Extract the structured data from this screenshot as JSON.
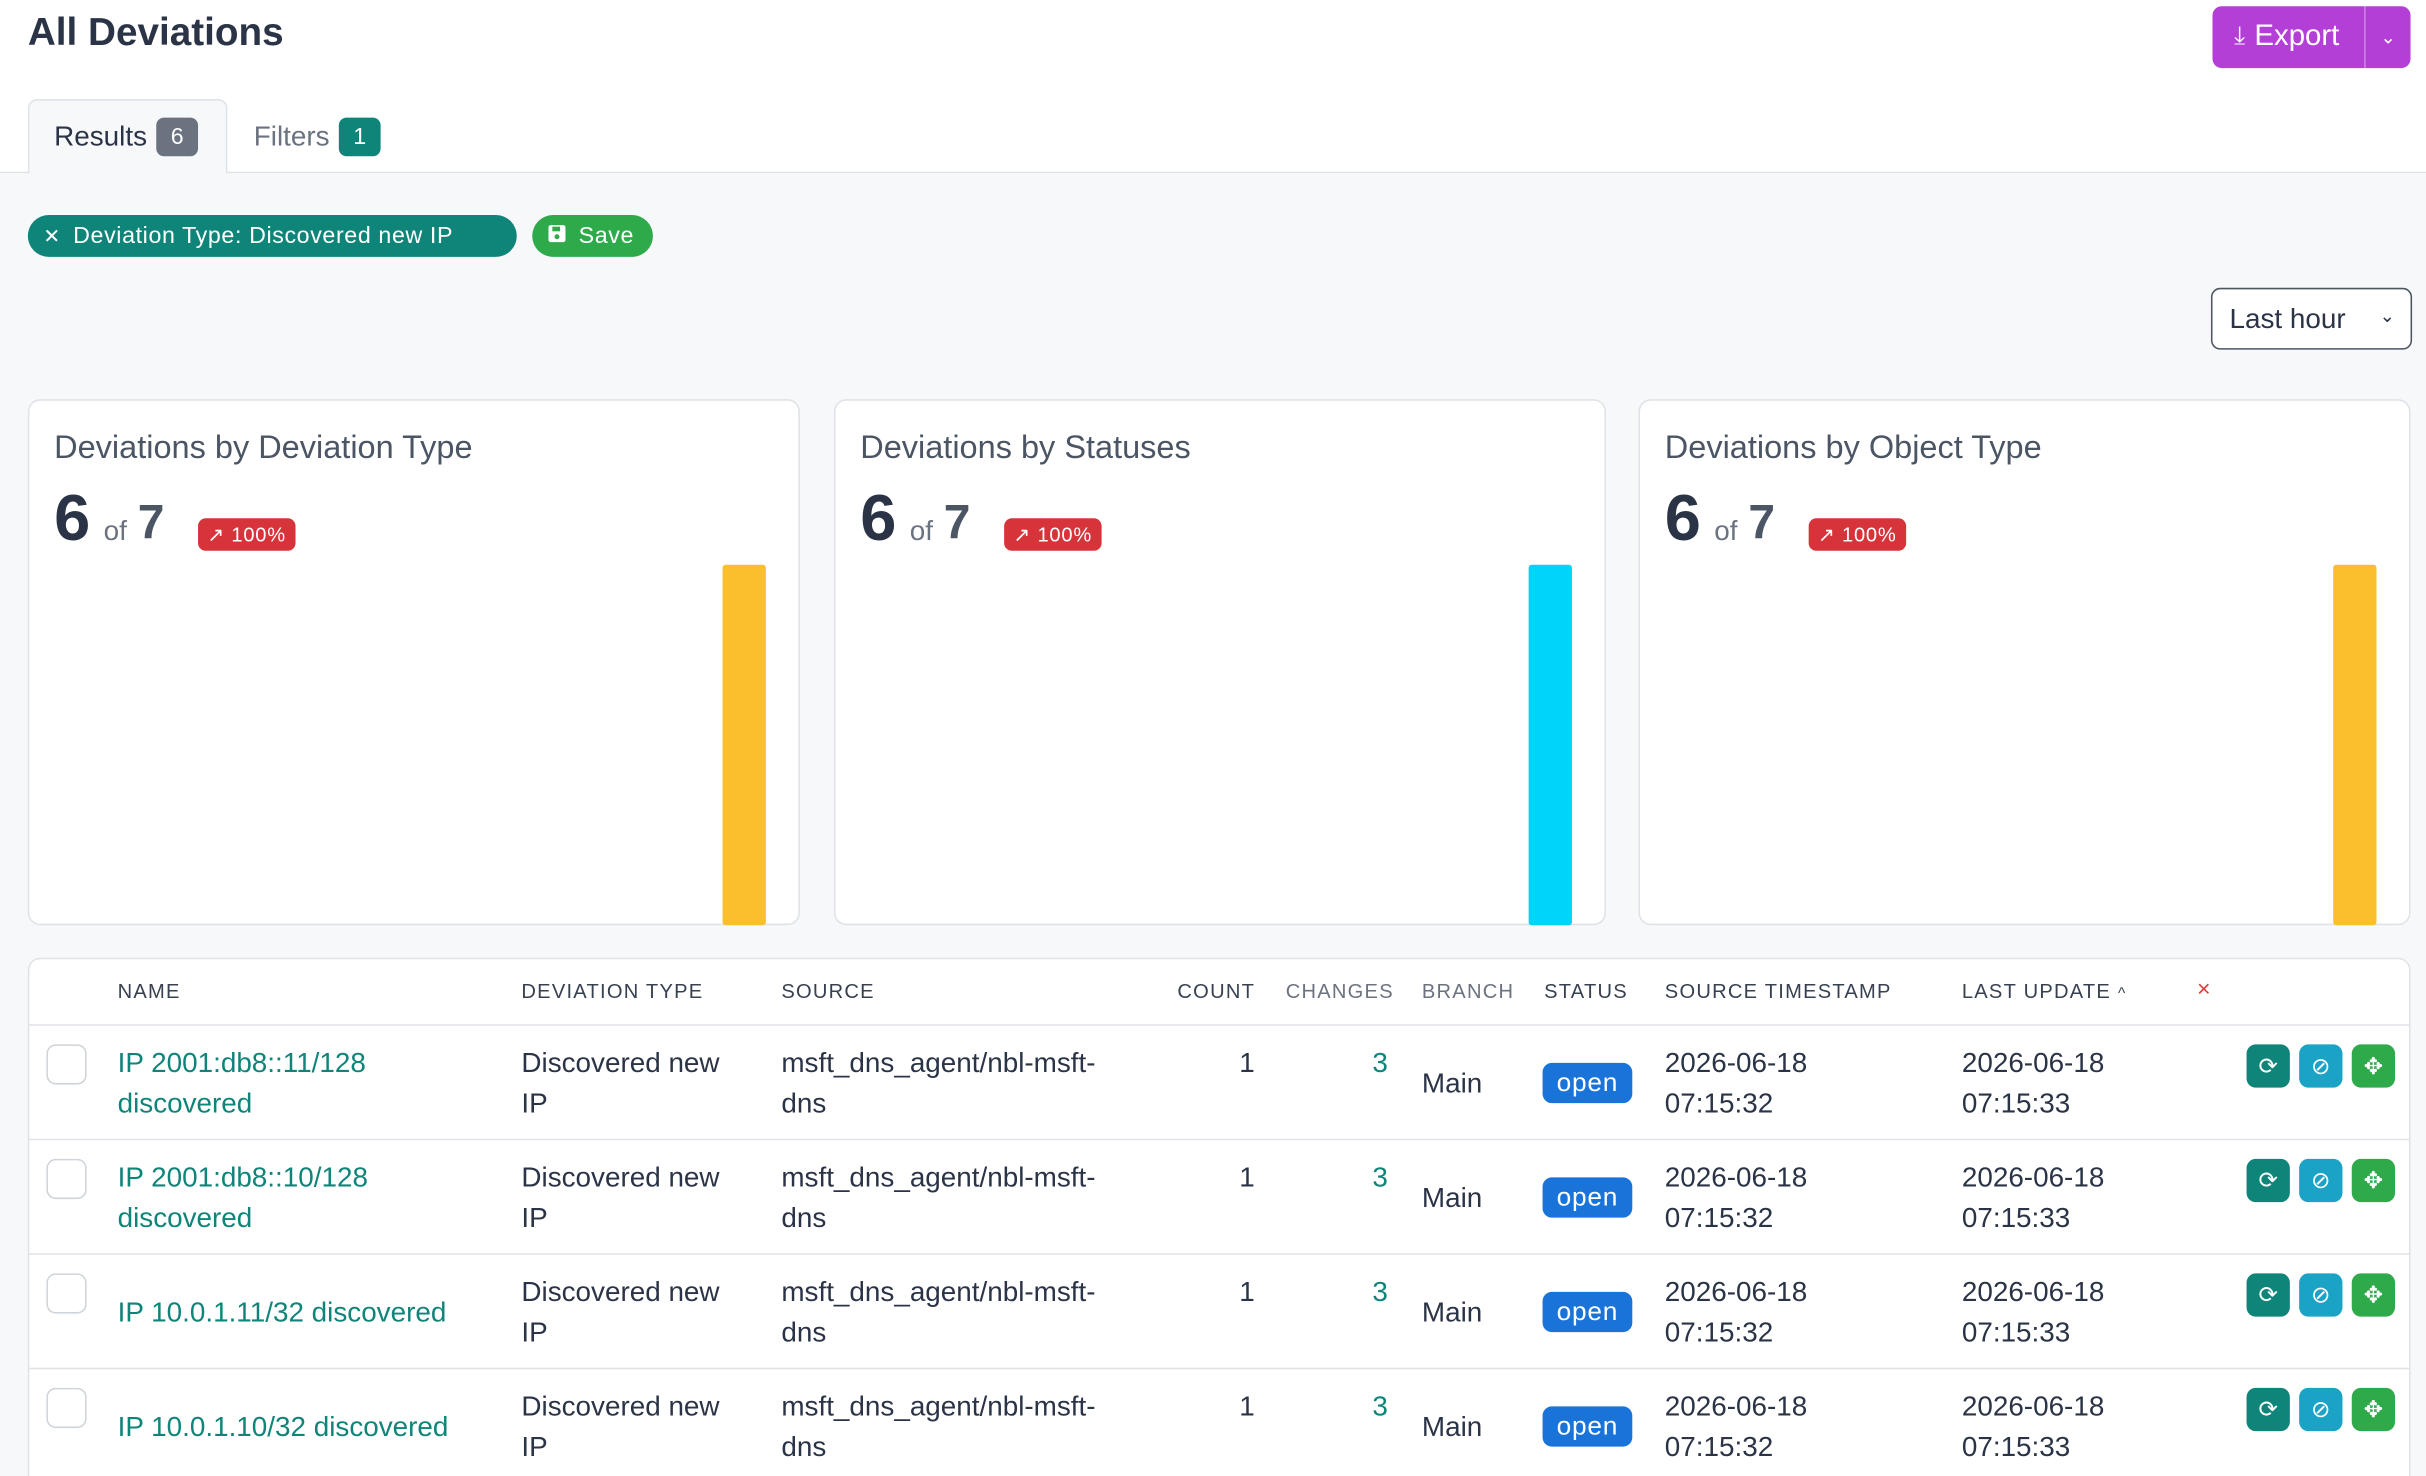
{
  "page": {
    "title": "All Deviations"
  },
  "toolbar": {
    "export_label": "Export",
    "export_icon": "download-icon"
  },
  "tabs": [
    {
      "label": "Results",
      "count": "6"
    },
    {
      "label": "Filters",
      "count": "1"
    }
  ],
  "filters": {
    "active_filter": "Deviation Type: Discovered new IP",
    "save_label": "Save"
  },
  "time_range": {
    "selected": "Last hour"
  },
  "cards": [
    {
      "title": "Deviations by Deviation Type",
      "value": "6",
      "of": "of",
      "total": "7",
      "change": "100%",
      "bar_color": "#fbbf2e"
    },
    {
      "title": "Deviations by Statuses",
      "value": "6",
      "of": "of",
      "total": "7",
      "change": "100%",
      "bar_color": "#00d4fa"
    },
    {
      "title": "Deviations by Object Type",
      "value": "6",
      "of": "of",
      "total": "7",
      "change": "100%",
      "bar_color": "#fbbf2e"
    }
  ],
  "chart_data": [
    {
      "type": "bar",
      "title": "Deviations by Deviation Type",
      "series": [
        {
          "values": [
            6
          ],
          "color": "#fbbf2e"
        }
      ]
    },
    {
      "type": "bar",
      "title": "Deviations by Statuses",
      "series": [
        {
          "values": [
            6
          ],
          "color": "#00d4fa"
        }
      ]
    },
    {
      "type": "bar",
      "title": "Deviations by Object Type",
      "series": [
        {
          "values": [
            6
          ],
          "color": "#fbbf2e"
        }
      ]
    }
  ],
  "table": {
    "columns": {
      "name": "NAME",
      "deviation_type": "DEVIATION TYPE",
      "source": "SOURCE",
      "count": "COUNT",
      "changes": "CHANGES",
      "branch": "BRANCH",
      "status": "STATUS",
      "source_timestamp": "SOURCE TIMESTAMP",
      "last_update": "LAST UPDATE",
      "sort_indicator": "^",
      "clear": "×"
    },
    "rows": [
      {
        "name_l1": "IP 2001:db8::11/128",
        "name_l2": "discovered",
        "type_l1": "Discovered new",
        "type_l2": "IP",
        "source_l1": "msft_dns_agent/nbl-msft-",
        "source_l2": "dns",
        "count": "1",
        "changes": "3",
        "branch": "Main",
        "status": "open",
        "src_date": "2026-06-18",
        "src_time": "07:15:32",
        "upd_date": "2026-06-18",
        "upd_time": "07:15:33"
      },
      {
        "name_l1": "IP 2001:db8::10/128",
        "name_l2": "discovered",
        "type_l1": "Discovered new",
        "type_l2": "IP",
        "source_l1": "msft_dns_agent/nbl-msft-",
        "source_l2": "dns",
        "count": "1",
        "changes": "3",
        "branch": "Main",
        "status": "open",
        "src_date": "2026-06-18",
        "src_time": "07:15:32",
        "upd_date": "2026-06-18",
        "upd_time": "07:15:33"
      },
      {
        "name_l1": "IP 10.0.1.11/32 discovered",
        "name_l2": "",
        "type_l1": "Discovered new",
        "type_l2": "IP",
        "source_l1": "msft_dns_agent/nbl-msft-",
        "source_l2": "dns",
        "count": "1",
        "changes": "3",
        "branch": "Main",
        "status": "open",
        "src_date": "2026-06-18",
        "src_time": "07:15:32",
        "upd_date": "2026-06-18",
        "upd_time": "07:15:33"
      },
      {
        "name_l1": "IP 10.0.1.10/32 discovered",
        "name_l2": "",
        "type_l1": "Discovered new",
        "type_l2": "IP",
        "source_l1": "msft_dns_agent/nbl-msft-",
        "source_l2": "dns",
        "count": "1",
        "changes": "3",
        "branch": "Main",
        "status": "open",
        "src_date": "2026-06-18",
        "src_time": "07:15:32",
        "upd_date": "2026-06-18",
        "upd_time": "07:15:33"
      }
    ]
  },
  "row_actions": [
    "refresh-icon",
    "eye-off-icon",
    "move-icon"
  ]
}
